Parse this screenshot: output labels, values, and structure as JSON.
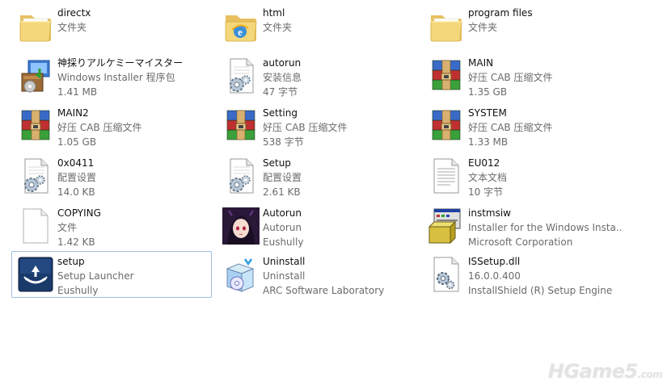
{
  "files": [
    {
      "name": "directx",
      "line2": "文件夹",
      "line3": "",
      "icon": "folder-icon"
    },
    {
      "name": "html",
      "line2": "文件夹",
      "line3": "",
      "icon": "ie-folder-icon"
    },
    {
      "name": "program files",
      "line2": "文件夹",
      "line3": "",
      "icon": "folder-icon"
    },
    {
      "name": "神採りアルケミーマイスター",
      "line2": "Windows Installer 程序包",
      "line3": "1.41 MB",
      "icon": "installer-package-icon"
    },
    {
      "name": "autorun",
      "line2": "安装信息",
      "line3": "47 字节",
      "icon": "settings-file-icon"
    },
    {
      "name": "MAIN",
      "line2": "好压 CAB 压缩文件",
      "line3": "1.35 GB",
      "icon": "archive-icon"
    },
    {
      "name": "MAIN2",
      "line2": "好压 CAB 压缩文件",
      "line3": "1.05 GB",
      "icon": "archive-icon"
    },
    {
      "name": "Setting",
      "line2": "好压 CAB 压缩文件",
      "line3": "538 字节",
      "icon": "archive-icon"
    },
    {
      "name": "SYSTEM",
      "line2": "好压 CAB 压缩文件",
      "line3": "1.33 MB",
      "icon": "archive-icon"
    },
    {
      "name": "0x0411",
      "line2": "配置设置",
      "line3": "14.0 KB",
      "icon": "settings-file-icon"
    },
    {
      "name": "Setup",
      "line2": "配置设置",
      "line3": "2.61 KB",
      "icon": "settings-file-icon"
    },
    {
      "name": "EU012",
      "line2": "文本文档",
      "line3": "10 字节",
      "icon": "text-file-icon"
    },
    {
      "name": "COPYING",
      "line2": "文件",
      "line3": "1.42 KB",
      "icon": "blank-file-icon"
    },
    {
      "name": "Autorun",
      "line2": "Autorun",
      "line3": "Eushully",
      "icon": "anime-character-icon"
    },
    {
      "name": "instmsiw",
      "line2": "Installer for the Windows Insta...",
      "line3": "Microsoft Corporation",
      "icon": "msi-installer-icon"
    },
    {
      "name": "setup",
      "line2": "Setup Launcher",
      "line3": "Eushully",
      "icon": "launcher-icon",
      "selected": true
    },
    {
      "name": "Uninstall",
      "line2": "Uninstall",
      "line3": "ARC Software Laboratory",
      "icon": "uninstall-box-icon"
    },
    {
      "name": "ISSetup.dll",
      "line2": "16.0.0.400",
      "line3": "InstallShield (R) Setup Engine",
      "icon": "dll-file-icon"
    }
  ],
  "watermark": {
    "main": "HGame5",
    "suffix": ".com"
  }
}
